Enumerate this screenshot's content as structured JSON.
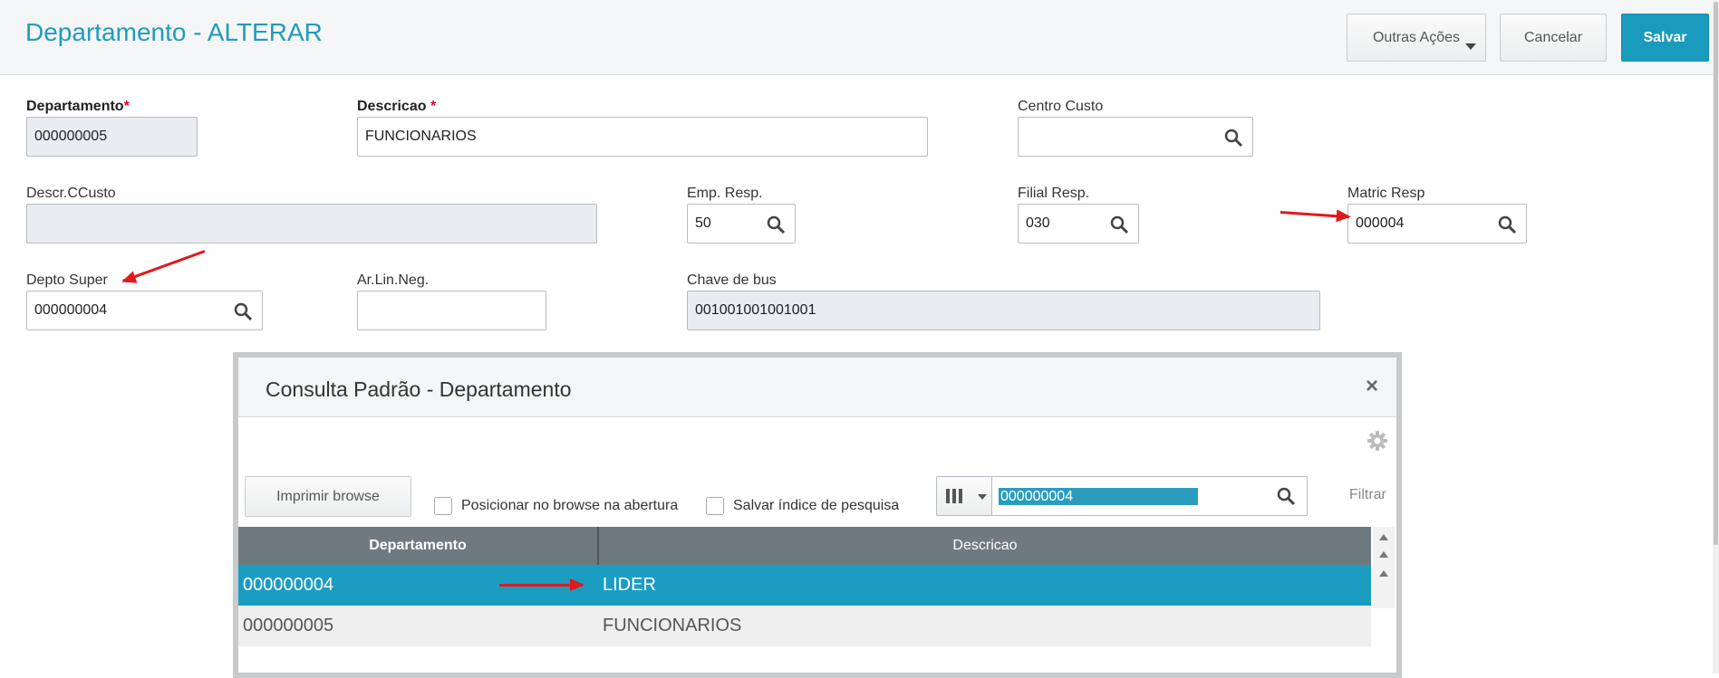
{
  "header": {
    "title": "Departamento - ALTERAR",
    "buttons": {
      "outras_acoes": "Outras Ações",
      "cancelar": "Cancelar",
      "salvar": "Salvar"
    }
  },
  "form": {
    "departamento": {
      "label": "Departamento",
      "required_mark": "*",
      "value": "000000005"
    },
    "descricao": {
      "label": "Descricao",
      "required_mark": "*",
      "value": "FUNCIONARIOS"
    },
    "centro_custo": {
      "label": "Centro Custo",
      "value": ""
    },
    "descr_ccusto": {
      "label": "Descr.CCusto",
      "value": ""
    },
    "emp_resp": {
      "label": "Emp. Resp.",
      "value": "50"
    },
    "filial_resp": {
      "label": "Filial Resp.",
      "value": "030"
    },
    "matric_resp": {
      "label": "Matric Resp",
      "value": "000004"
    },
    "depto_super": {
      "label": "Depto Super",
      "value": "000000004"
    },
    "ar_lin_neg": {
      "label": "Ar.Lin.Neg.",
      "value": ""
    },
    "chave_de_bus": {
      "label": "Chave de bus",
      "value": "001001001001001"
    }
  },
  "dialog": {
    "title": "Consulta Padrão - Departamento",
    "close_symbol": "×",
    "print_button": "Imprimir browse",
    "checkbox_posicionar": "Posicionar no browse na abertura",
    "checkbox_salvar_indice": "Salvar índice de pesquisa",
    "search_value": "000000004",
    "filter_label": "Filtrar",
    "grid": {
      "columns": [
        "Departamento",
        "Descricao"
      ],
      "rows": [
        {
          "departamento": "000000004",
          "descricao": "LIDER",
          "selected": true
        },
        {
          "departamento": "000000005",
          "descricao": "FUNCIONARIOS",
          "selected": false
        }
      ]
    }
  },
  "colors": {
    "accent": "#1a9bbd",
    "selected_row": "#1b9dc2",
    "annotation_arrow": "#e0191d",
    "grid_header": "#6f7a80"
  }
}
